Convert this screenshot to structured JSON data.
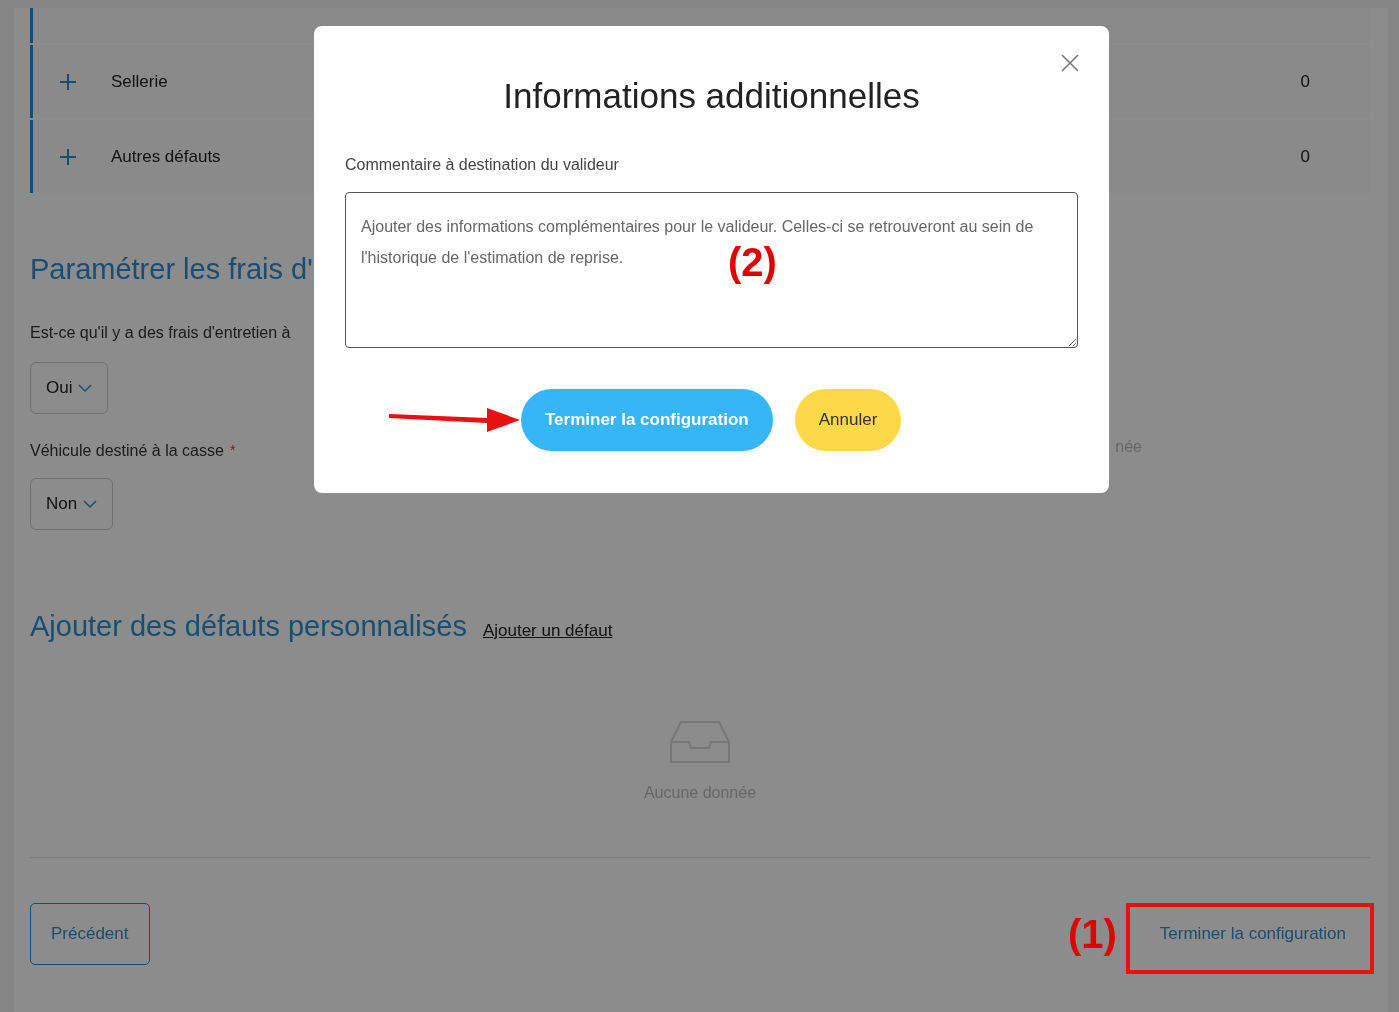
{
  "defect_rows": [
    {
      "label": "Sellerie",
      "count": "0"
    },
    {
      "label": "Autres défauts",
      "count": "0"
    }
  ],
  "maintenance_section": {
    "heading": "Paramétrer les frais d'",
    "question": "Est-ce qu'il y a des frais d'entretien à",
    "answer": "Oui",
    "scrap_label": "Véhicule destiné à la casse",
    "required_mark": "*",
    "scrap_answer": "Non",
    "hidden_fragment": "née"
  },
  "custom_defects": {
    "heading": "Ajouter des défauts personnalisés",
    "link": "Ajouter un défaut",
    "empty_text": "Aucune donnée"
  },
  "footer": {
    "back_button": "Précédent",
    "finish_button": "Terminer la configuration"
  },
  "modal": {
    "title": "Informations additionnelles",
    "field_label": "Commentaire à destination du valideur",
    "placeholder": "Ajouter des informations complémentaires pour le valideur. Celles-ci se retrouveront au sein de l'historique de l'estimation de reprise.",
    "primary_button": "Terminer la configuration",
    "cancel_button": "Annuler"
  },
  "annotations": {
    "footer_marker": "(1)",
    "modal_marker": "(2)"
  }
}
